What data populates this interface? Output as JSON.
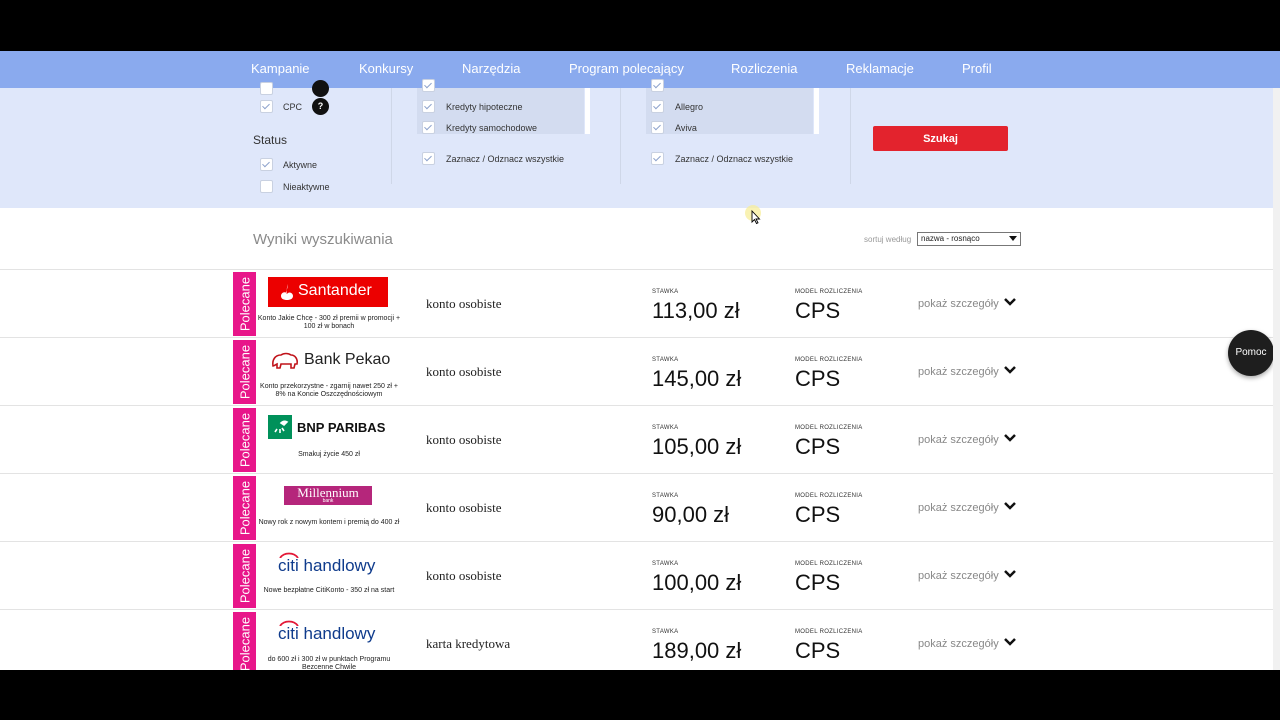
{
  "nav": {
    "items": [
      "Kampanie",
      "Konkursy",
      "Narzędzia",
      "Program polecający",
      "Rozliczenia",
      "Reklamacje",
      "Profil"
    ]
  },
  "filters": {
    "cpc_label": "CPC",
    "help_mark": "?",
    "status_heading": "Status",
    "status_active": "Aktywne",
    "status_inactive": "Nieaktywne",
    "categories": [
      "Kredyty hipoteczne",
      "Kredyty samochodowe"
    ],
    "advertisers": [
      "Allegro",
      "Aviva"
    ],
    "select_all_1": "Zaznacz / Odznacz wszystkie",
    "select_all_2": "Zaznacz / Odznacz wszystkie",
    "search_button": "Szukaj"
  },
  "results": {
    "title": "Wyniki wyszukiwania",
    "sort_label": "sortuj według",
    "sort_value": "nazwa - rosnąco"
  },
  "rows": [
    {
      "badge": "Polecane",
      "brand": "Santander",
      "offer": "Konto Jakie Chcę - 300 zł premii w promocji + 100 zł w bonach",
      "product": "konto osobiste",
      "rate_label": "STAWKA",
      "rate": "113,00 zł",
      "model_label": "MODEL ROZLICZENIA",
      "model": "CPS",
      "details": "pokaż szczegóły"
    },
    {
      "badge": "Polecane",
      "brand": "Bank Pekao",
      "offer": "Konto przekorzystne - zgarnij nawet 250 zł + 8% na Koncie Oszczędnościowym",
      "product": "konto osobiste",
      "rate_label": "STAWKA",
      "rate": "145,00 zł",
      "model_label": "MODEL ROZLICZENIA",
      "model": "CPS",
      "details": "pokaż szczegóły"
    },
    {
      "badge": "Polecane",
      "brand": "BNP PARIBAS",
      "offer": "Smakuj życie 450 zł",
      "product": "konto osobiste",
      "rate_label": "STAWKA",
      "rate": "105,00 zł",
      "model_label": "MODEL ROZLICZENIA",
      "model": "CPS",
      "details": "pokaż szczegóły"
    },
    {
      "badge": "Polecane",
      "brand": "Millennium",
      "brand_sub": "bank",
      "offer": "Nowy rok z nowym kontem i premią do 400 zł",
      "product": "konto osobiste",
      "rate_label": "STAWKA",
      "rate": "90,00 zł",
      "model_label": "MODEL ROZLICZENIA",
      "model": "CPS",
      "details": "pokaż szczegóły"
    },
    {
      "badge": "Polecane",
      "brand": "citi handlowy",
      "offer": "Nowe bezpłatne CitiKonto - 350 zł na start",
      "product": "konto osobiste",
      "rate_label": "STAWKA",
      "rate": "100,00 zł",
      "model_label": "MODEL ROZLICZENIA",
      "model": "CPS",
      "details": "pokaż szczegóły"
    },
    {
      "badge": "Polecane",
      "brand": "citi handlowy",
      "offer": "do 600 zł i 300 zł w punktach Programu Bezcenne Chwile",
      "product": "karta kredytowa",
      "rate_label": "STAWKA",
      "rate": "189,00 zł",
      "model_label": "MODEL ROZLICZENIA",
      "model": "CPS",
      "details": "pokaż szczegóły"
    }
  ],
  "help": {
    "label": "Pomoc"
  },
  "colors": {
    "nav_bg": "#8aaaee",
    "filter_bg": "#dfe7fa",
    "badge": "#e8168a",
    "search_button": "#e3232d",
    "santander": "#ec0000",
    "millennium": "#b5267b",
    "bnp_green": "#00915a",
    "citi_blue": "#0f3b8c"
  }
}
